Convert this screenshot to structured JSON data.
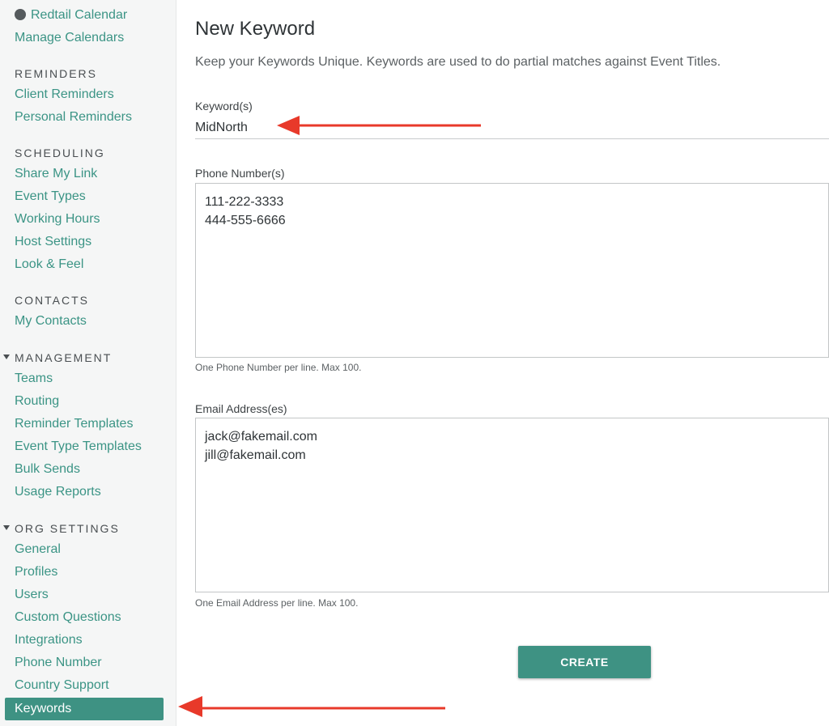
{
  "sidebar": {
    "calendars": {
      "redtail": "Redtail Calendar",
      "manage": "Manage Calendars"
    },
    "reminders": {
      "heading": "REMINDERS",
      "client": "Client Reminders",
      "personal": "Personal Reminders"
    },
    "scheduling": {
      "heading": "SCHEDULING",
      "share_link": "Share My Link",
      "event_types": "Event Types",
      "working_hours": "Working Hours",
      "host_settings": "Host Settings",
      "look_feel": "Look & Feel"
    },
    "contacts": {
      "heading": "CONTACTS",
      "my_contacts": "My Contacts"
    },
    "management": {
      "heading": "MANAGEMENT",
      "teams": "Teams",
      "routing": "Routing",
      "reminder_templates": "Reminder Templates",
      "event_type_templates": "Event Type Templates",
      "bulk_sends": "Bulk Sends",
      "usage_reports": "Usage Reports"
    },
    "org_settings": {
      "heading": "ORG SETTINGS",
      "general": "General",
      "profiles": "Profiles",
      "users": "Users",
      "custom_questions": "Custom Questions",
      "integrations": "Integrations",
      "phone_number": "Phone Number",
      "country_support": "Country Support",
      "keywords": "Keywords"
    }
  },
  "main": {
    "title": "New Keyword",
    "description": "Keep your Keywords Unique. Keywords are used to do partial matches against Event Titles.",
    "keyword": {
      "label": "Keyword(s)",
      "value": "MidNorth"
    },
    "phones": {
      "label": "Phone Number(s)",
      "value": "111-222-3333\n444-555-6666",
      "hint": "One Phone Number per line. Max 100."
    },
    "emails": {
      "label": "Email Address(es)",
      "value": "jack@fakemail.com\njill@fakemail.com",
      "hint": "One Email Address per line. Max 100."
    },
    "create_label": "CREATE"
  },
  "colors": {
    "accent": "#3e9283",
    "link": "#3b9485",
    "annotation_arrow": "#e8392a"
  }
}
